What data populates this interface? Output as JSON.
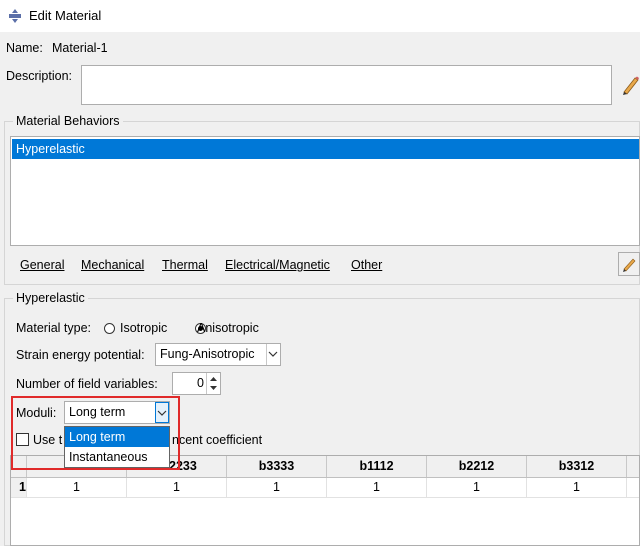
{
  "window": {
    "title": "Edit Material"
  },
  "material": {
    "name_label": "Name:",
    "name": "Material-1",
    "description_label": "Description:",
    "description": ""
  },
  "behaviors": {
    "group_title": "Material Behaviors",
    "items": [
      "Hyperelastic"
    ]
  },
  "menu": [
    "General",
    "Mechanical",
    "Thermal",
    "Electrical/Magnetic",
    "Other"
  ],
  "hyperelastic": {
    "group_title": "Hyperelastic",
    "material_type_label": "Material type:",
    "material_type_options": [
      "Isotropic",
      "Anisotropic"
    ],
    "material_type_selected": "Anisotropic",
    "strain_energy_label": "Strain energy potential:",
    "strain_energy_value": "Fung-Anisotropic",
    "field_vars_label": "Number of field variables:",
    "field_vars_value": "0",
    "moduli_label": "Moduli:",
    "moduli_value": "Long term",
    "moduli_options": [
      "Long term",
      "Instantaneous"
    ],
    "checkbox_label_start": "Use t",
    "checkbox_label_end": "ncent coefficient"
  },
  "table": {
    "headers": [
      "",
      "b",
      "2233",
      "b3333",
      "b1112",
      "b2212",
      "b3312"
    ],
    "rows": [
      [
        "1",
        "1",
        "1",
        "1",
        "1",
        "1",
        "1"
      ]
    ]
  }
}
